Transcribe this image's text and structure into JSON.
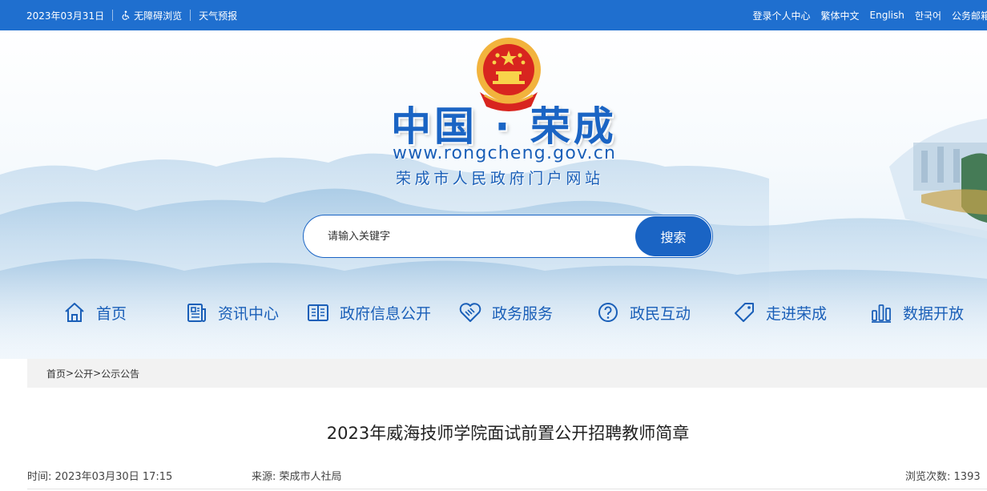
{
  "colors": {
    "brand_blue": "#1f6fcf",
    "title_blue": "#1a64c4",
    "emblem_red": "#d8251f",
    "emblem_gold": "#f2b33d"
  },
  "topbar": {
    "date": "2023年03月31日",
    "accessibility": "无障碍浏览",
    "weather": "天气预报",
    "links": [
      "登录个人中心",
      "繁体中文",
      "English",
      "한국어",
      "公务邮箱"
    ]
  },
  "header": {
    "title": "中国 · 荣成",
    "url": "www.rongcheng.gov.cn",
    "subtitle": "荣成市人民政府门户网站"
  },
  "search": {
    "placeholder": "请输入关键字",
    "button": "搜索"
  },
  "nav": [
    {
      "label": "首页",
      "icon": "home-icon"
    },
    {
      "label": "资讯中心",
      "icon": "news-icon"
    },
    {
      "label": "政府信息公开",
      "icon": "book-icon"
    },
    {
      "label": "政务服务",
      "icon": "handshake-icon"
    },
    {
      "label": "政民互动",
      "icon": "question-icon"
    },
    {
      "label": "走进荣成",
      "icon": "tag-icon"
    },
    {
      "label": "数据开放",
      "icon": "bar-chart-icon"
    }
  ],
  "breadcrumb": [
    "首页",
    ">",
    "公开",
    ">",
    "公示公告"
  ],
  "article": {
    "title": "2023年威海技师学院面试前置公开招聘教师简章",
    "time_label": "时间:",
    "time": "2023年03月30日 17:15",
    "source_label": "来源:",
    "source": "荣成市人社局",
    "views_label": "浏览次数:",
    "views": "1393"
  }
}
